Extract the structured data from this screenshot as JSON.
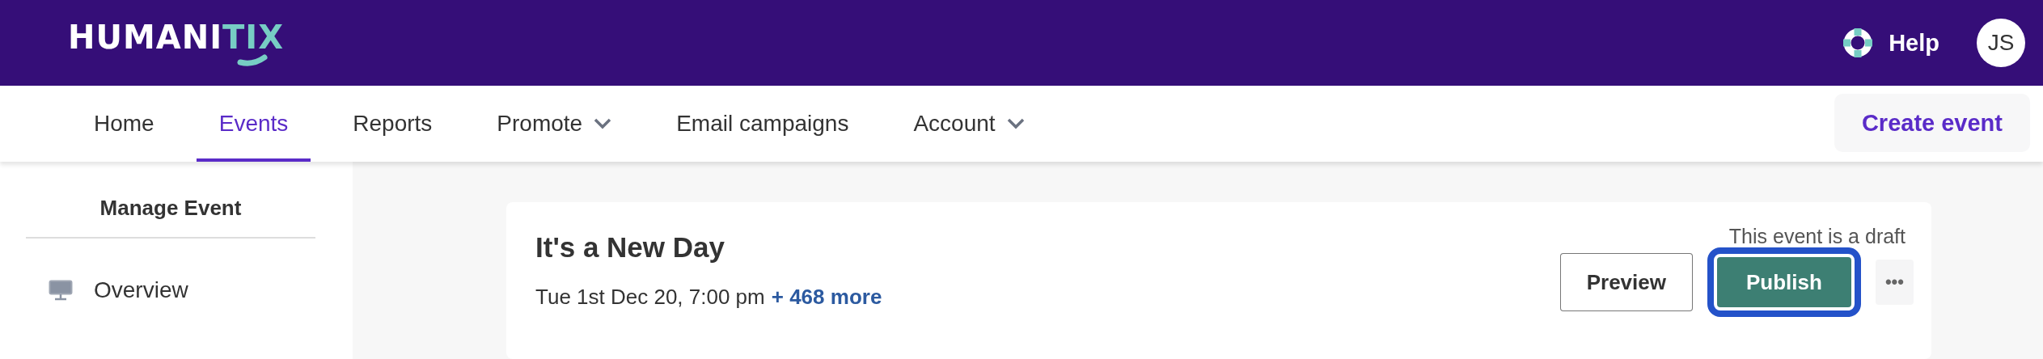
{
  "header": {
    "logo": {
      "main": "HUMANI",
      "accent": "TIX"
    },
    "help": "Help",
    "avatar": "JS"
  },
  "nav": {
    "items": [
      {
        "label": "Home",
        "selected": false,
        "dropdown": false
      },
      {
        "label": "Events",
        "selected": true,
        "dropdown": false
      },
      {
        "label": "Reports",
        "selected": false,
        "dropdown": false
      },
      {
        "label": "Promote",
        "selected": false,
        "dropdown": true
      },
      {
        "label": "Email campaigns",
        "selected": false,
        "dropdown": false
      },
      {
        "label": "Account",
        "selected": false,
        "dropdown": true
      }
    ],
    "create_button": "Create event"
  },
  "sidebar": {
    "title": "Manage Event",
    "items": [
      {
        "label": "Overview"
      }
    ]
  },
  "event": {
    "title": "It's a New Day",
    "date": "Tue 1st Dec 20, 7:00 pm",
    "more_link": "+ 468 more",
    "status": "This event is a draft",
    "buttons": {
      "preview": "Preview",
      "publish": "Publish",
      "more": "•••"
    }
  }
}
